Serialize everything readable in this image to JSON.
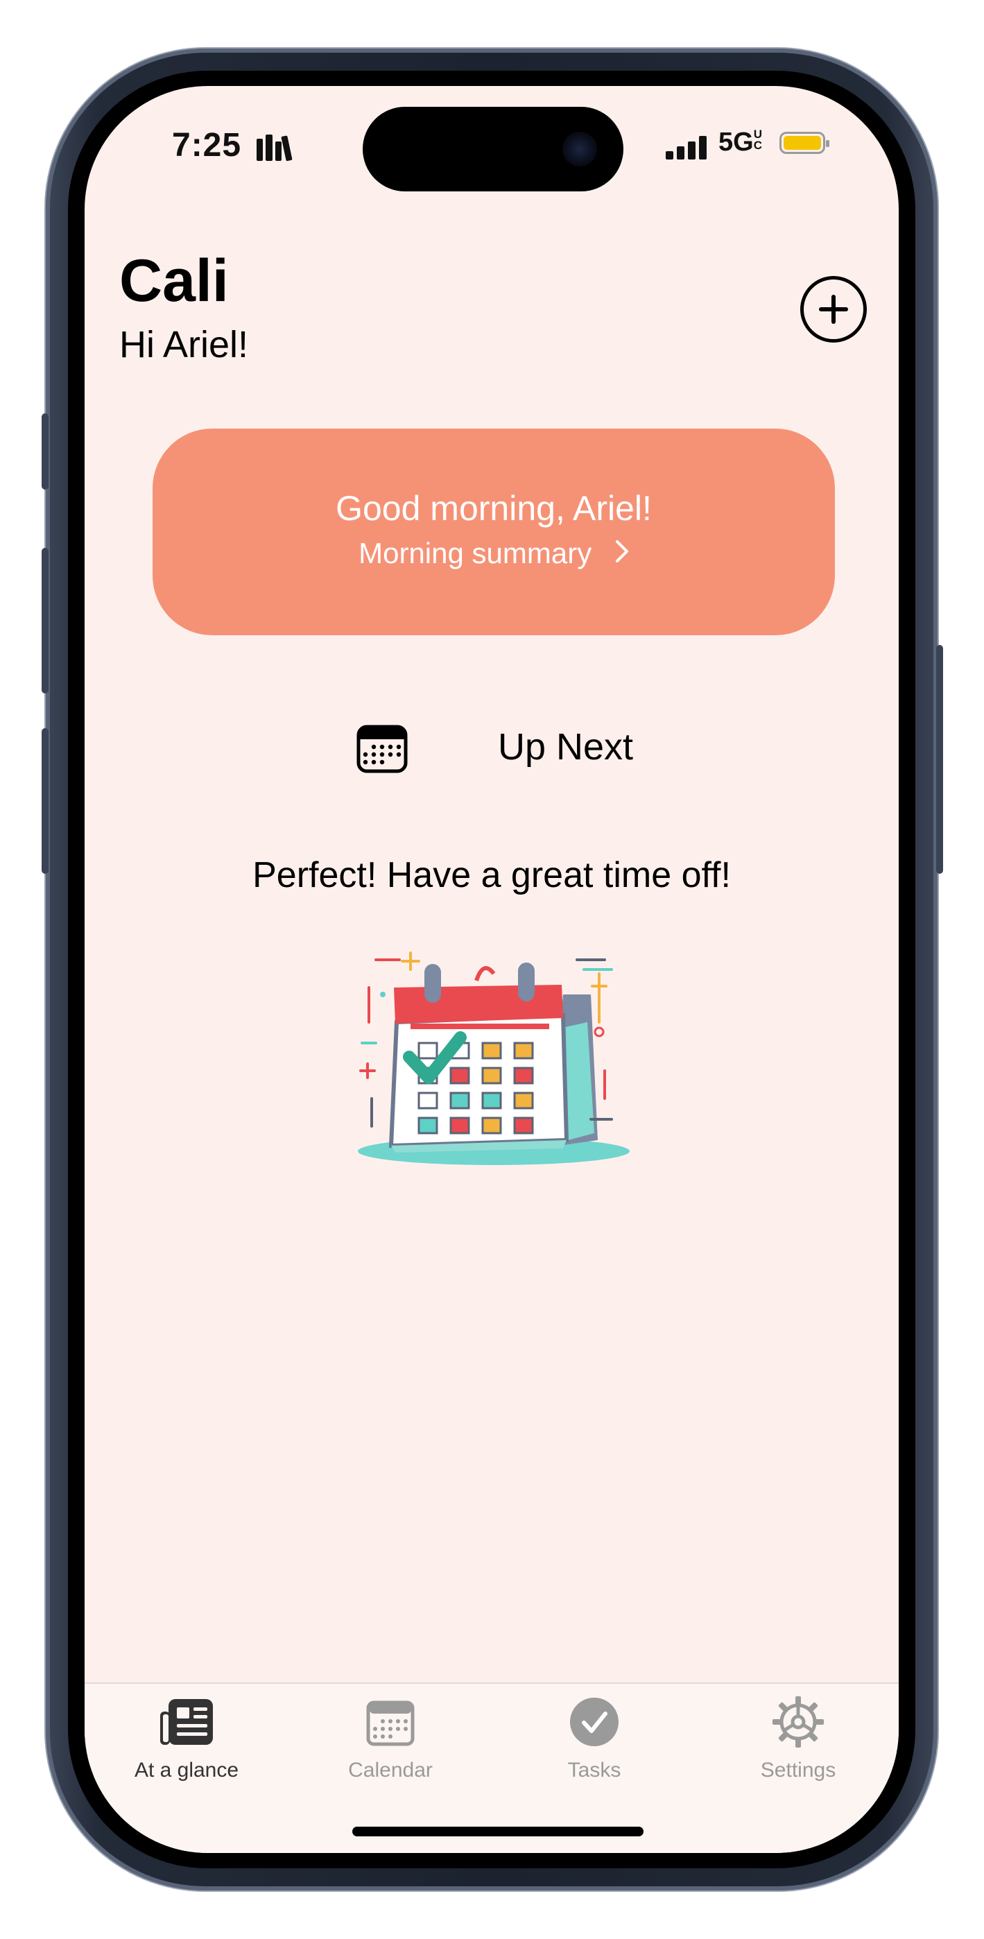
{
  "status_bar": {
    "time": "7:25",
    "network": "5GUC",
    "network_main": "5G",
    "network_sup": "UC",
    "icons": [
      "library-icon",
      "signal-icon",
      "battery-icon"
    ],
    "battery_level": 1.0,
    "battery_color": "#f5c400"
  },
  "header": {
    "app_title": "Cali",
    "greeting": "Hi Ariel!",
    "add_icon": "plus-circle-icon"
  },
  "summary_card": {
    "title": "Good morning, Ariel!",
    "link_label": "Morning summary",
    "link_icon": "chevron-right-icon",
    "color": "#f59276"
  },
  "up_next": {
    "icon": "calendar-icon",
    "label": "Up Next",
    "empty_message": "Perfect! Have a great time off!",
    "illustration": "calendar-checkmark-illustration"
  },
  "tab_bar": {
    "tabs": [
      {
        "label": "At a glance",
        "icon": "newspaper-icon",
        "active": true
      },
      {
        "label": "Calendar",
        "icon": "calendar-icon",
        "active": false
      },
      {
        "label": "Tasks",
        "icon": "checkmark-circle-icon",
        "active": false
      },
      {
        "label": "Settings",
        "icon": "gear-icon",
        "active": false
      }
    ],
    "active_color": "#333333",
    "inactive_color": "#9a9a9a"
  },
  "theme": {
    "background": "#fdf0ec",
    "accent": "#f59276"
  }
}
